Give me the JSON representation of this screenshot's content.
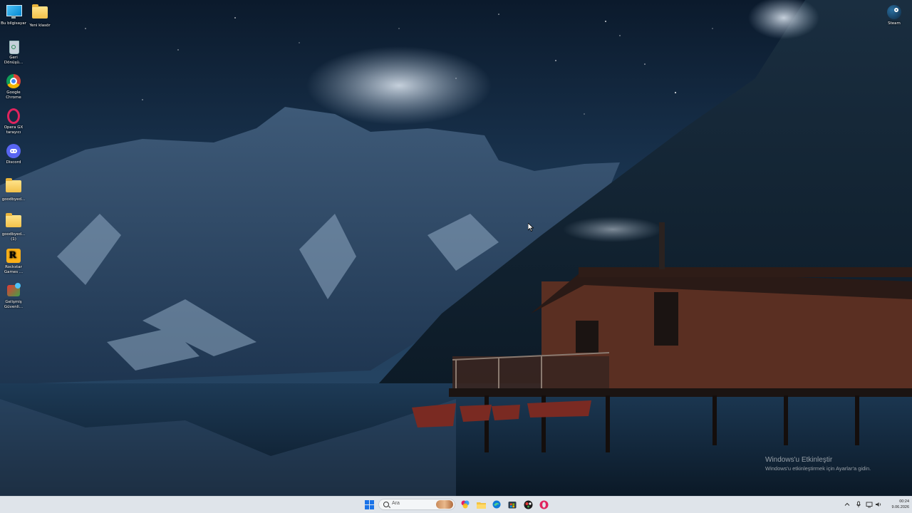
{
  "desktop_icons": [
    {
      "id": "computer",
      "label": "Bu bilgisayar"
    },
    {
      "id": "new-folder",
      "label": "Yeni klasör"
    },
    {
      "id": "steam",
      "label": "Steam"
    },
    {
      "id": "recycle-bin",
      "label": "Geri Dönüşü..."
    },
    {
      "id": "chrome",
      "label": "Google Chrome"
    },
    {
      "id": "opera-gx",
      "label": "Opera GX tarayıcı"
    },
    {
      "id": "discord",
      "label": "Discord"
    },
    {
      "id": "folder-goodbye-1",
      "label": "goodbyed..."
    },
    {
      "id": "folder-goodbye-2",
      "label": "goodbyed... (1)"
    },
    {
      "id": "rockstar",
      "label": "Rockstar Games ..."
    },
    {
      "id": "gelismis",
      "label": "Gelişmiş Güvenli..."
    }
  ],
  "activation": {
    "title": "Windows'u Etkinleştir",
    "subtitle": "Windows'u etkinleştirmek için Ayarlar'a gidin."
  },
  "taskbar": {
    "search_placeholder": "Ara",
    "apps": [
      "start-icon",
      "copilot-icon",
      "file-explorer-icon",
      "edge-icon",
      "store-icon",
      "game-app-icon",
      "opera-icon"
    ],
    "clock": {
      "time": "00:24",
      "date": "9.06.2026"
    }
  },
  "colors": {
    "taskbar_bg": "#dfe4ea",
    "sky_top": "#0d1f33",
    "cabin": "#5a2f22"
  }
}
